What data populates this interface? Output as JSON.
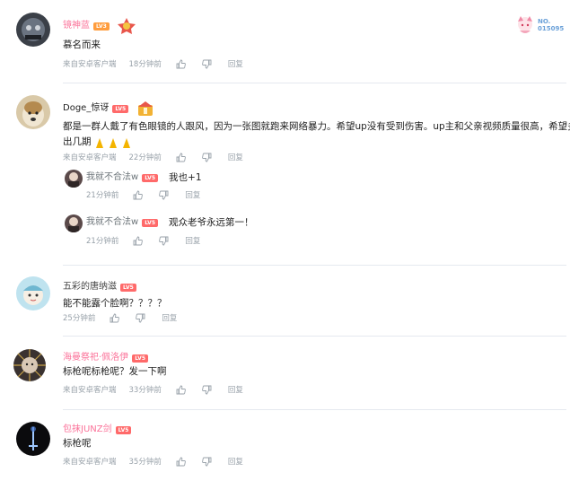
{
  "comments": [
    {
      "user": "镜神蓝",
      "level": "LV3",
      "text": "慕名而来",
      "source": "来自安卓客户端",
      "time": "18分钟前",
      "reply": "回复"
    },
    {
      "user": "Doge_惊讶",
      "level": "LV5",
      "text_line1": "都是一群人戴了有色眼镜的人跟风，因为一张图就跑来网络暴力。希望up没有受到伤害。up主和父亲视频质量很高，希望多多",
      "text_line2": "出几期",
      "source": "来自安卓客户端",
      "time": "22分钟前",
      "reply": "回复",
      "replies": [
        {
          "user": "我就不合法w",
          "level": "LV5",
          "text": "我也+1",
          "time": "21分钟前",
          "reply": "回复"
        },
        {
          "user": "我就不合法w",
          "level": "LV5",
          "text": "观众老爷永远第一！",
          "time": "21分钟前",
          "reply": "回复"
        }
      ]
    },
    {
      "user": "五彩的唐纳滋",
      "level": "LV5",
      "text": "能不能露个脸啊？？？？",
      "time": "25分钟前",
      "reply": "回复"
    },
    {
      "user": "海曼祭祀·佩洛伊",
      "level": "LV5",
      "text": "标枪呢标枪呢？发一下啊",
      "source": "来自安卓客户端",
      "time": "33分钟前",
      "reply": "回复"
    },
    {
      "user": "包抹JUNZ剑",
      "level": "LV5",
      "text": "标枪呢",
      "source": "来自安卓客户端",
      "time": "35分钟前",
      "reply": "回复"
    }
  ],
  "badge": {
    "label": "NO.",
    "number": "015095"
  },
  "colors": {
    "name_pink": "#fb7299",
    "meta_gray": "#99a2aa",
    "divider": "#e5e9ef",
    "level_orange": "#ff9d3e"
  }
}
